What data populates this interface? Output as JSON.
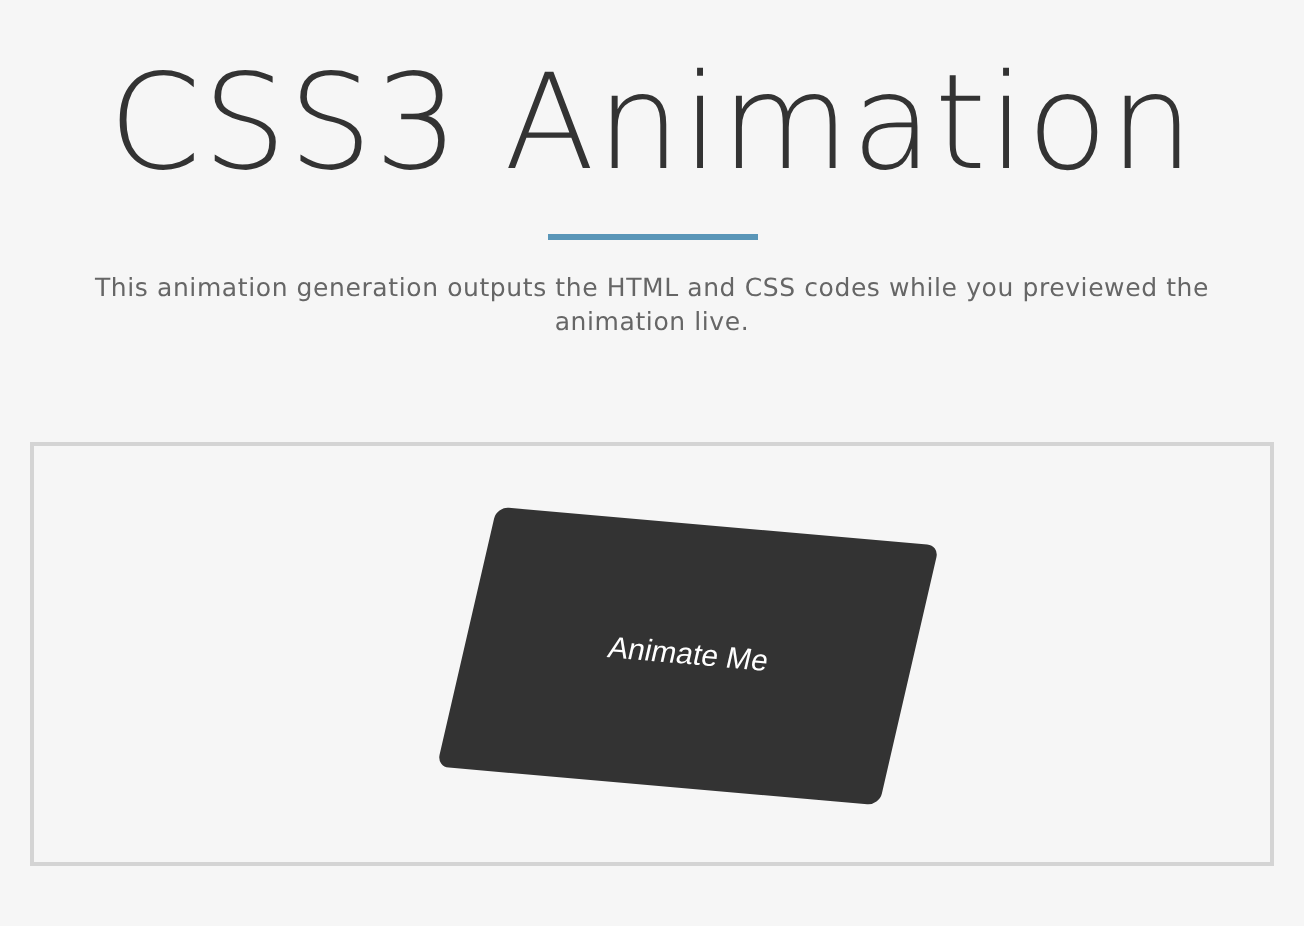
{
  "header": {
    "title": "CSS3 Animation",
    "description": "This animation generation outputs the HTML and CSS codes while you previewed the animation live."
  },
  "preview": {
    "card": {
      "label": "Animate Me"
    }
  }
}
